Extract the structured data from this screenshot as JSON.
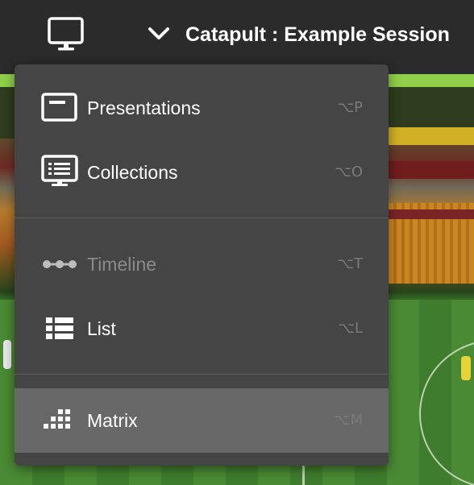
{
  "header": {
    "title": "Catapult : Example Session",
    "display_icon": "monitor-icon",
    "dropdown_icon": "chevron-down-icon"
  },
  "menu": {
    "sections": [
      {
        "items": [
          {
            "label": "Presentations",
            "shortcut": "⌥P",
            "icon": "presentation-icon",
            "enabled": true,
            "selected": false
          },
          {
            "label": "Collections",
            "shortcut": "⌥O",
            "icon": "collection-icon",
            "enabled": true,
            "selected": false
          }
        ]
      },
      {
        "items": [
          {
            "label": "Timeline",
            "shortcut": "⌥T",
            "icon": "timeline-icon",
            "enabled": false,
            "selected": false
          },
          {
            "label": "List",
            "shortcut": "⌥L",
            "icon": "list-icon",
            "enabled": true,
            "selected": false
          }
        ]
      },
      {
        "items": [
          {
            "label": "Matrix",
            "shortcut": "⌥M",
            "icon": "matrix-icon",
            "enabled": true,
            "selected": true
          }
        ]
      }
    ]
  },
  "colors": {
    "topbar": "#2b2b2b",
    "menu_bg": "#454545",
    "menu_selected": "#686868",
    "text": "#ffffff",
    "text_disabled": "#8a8a8a",
    "shortcut": "#7a7a7a"
  }
}
